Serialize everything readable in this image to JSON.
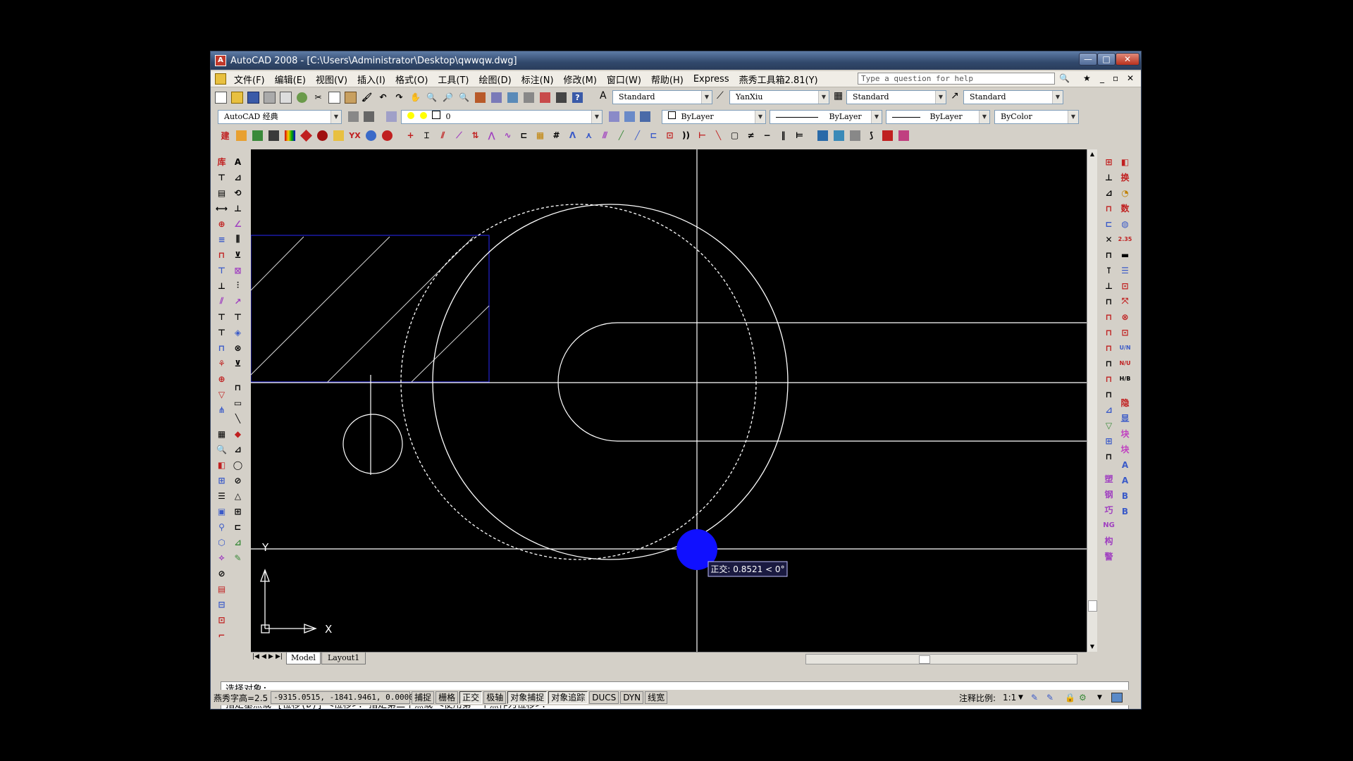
{
  "window": {
    "title": "AutoCAD 2008 - [C:\\Users\\Administrator\\Desktop\\qwwqw.dwg]"
  },
  "menu": [
    "文件(F)",
    "编辑(E)",
    "视图(V)",
    "插入(I)",
    "格式(O)",
    "工具(T)",
    "绘图(D)",
    "标注(N)",
    "修改(M)",
    "窗口(W)",
    "帮助(H)",
    "Express",
    "燕秀工具箱2.81(Y)"
  ],
  "help_placeholder": "Type a question for help",
  "styles": {
    "text_style": "Standard",
    "dim_style": "YanXiu",
    "table_style": "Standard",
    "multileader_style": "Standard"
  },
  "workspace": "AutoCAD 经典",
  "layer": "0",
  "properties": {
    "color": "ByLayer",
    "linetype": "ByLayer",
    "lineweight": "ByLayer",
    "plotstyle": "ByColor"
  },
  "tabs": [
    "Model",
    "Layout1"
  ],
  "canvas": {
    "ortho_tooltip": "正交: 0.8521 < 0°",
    "ucs_x": "X",
    "ucs_y": "Y",
    "colors": {
      "background": "#000000",
      "lines": "#ffffff",
      "rect": "#2020c0",
      "cursor_dot": "#1010ff"
    }
  },
  "command": {
    "line1": "选择对象:",
    "line2": "指定基点或 [位移(D)] <位移>:  指定第二个点或 <使用第一个点作为位移>:"
  },
  "status": {
    "text_height": "燕秀字高=2.5",
    "coords": "-9315.0515, -1841.9461, 0.0000",
    "toggles": [
      {
        "label": "捕捉",
        "on": false
      },
      {
        "label": "栅格",
        "on": false
      },
      {
        "label": "正交",
        "on": true
      },
      {
        "label": "极轴",
        "on": false
      },
      {
        "label": "对象捕捉",
        "on": true
      },
      {
        "label": "对象追踪",
        "on": true
      },
      {
        "label": "DUCS",
        "on": false
      },
      {
        "label": "DYN",
        "on": false
      },
      {
        "label": "线宽",
        "on": false
      }
    ],
    "anno_scale_label": "注释比例:",
    "anno_scale": "1:1"
  },
  "right_toolbar_labels": [
    "换",
    "数",
    "隐",
    "显",
    "块",
    "块",
    "塑",
    "钢",
    "巧",
    "NG",
    "构",
    "警"
  ],
  "left_toolbar_labels": [
    "库",
    "YX",
    "建"
  ]
}
